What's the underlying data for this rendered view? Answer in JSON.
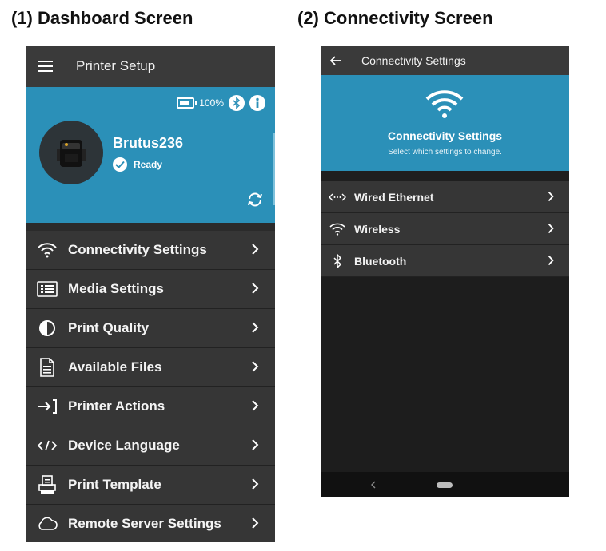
{
  "captions": {
    "left": "(1) Dashboard Screen",
    "right": "(2) Connectivity Screen"
  },
  "dashboard": {
    "title": "Printer Setup",
    "battery_text": "100%",
    "printer_name": "Brutus236",
    "printer_status": "Ready",
    "hero_color": "#2b90b8",
    "menu": [
      {
        "label": "Connectivity Settings",
        "icon": "wifi-icon"
      },
      {
        "label": "Media Settings",
        "icon": "list-icon"
      },
      {
        "label": "Print Quality",
        "icon": "contrast-icon"
      },
      {
        "label": "Available Files",
        "icon": "file-icon"
      },
      {
        "label": "Printer Actions",
        "icon": "enter-icon"
      },
      {
        "label": "Device Language",
        "icon": "code-icon"
      },
      {
        "label": "Print Template",
        "icon": "template-printer-icon"
      },
      {
        "label": "Remote Server Settings",
        "icon": "cloud-icon"
      }
    ]
  },
  "connectivity": {
    "title": "Connectivity Settings",
    "hero_title": "Connectivity Settings",
    "hero_subtitle": "Select which settings to change.",
    "items": [
      {
        "label": "Wired Ethernet",
        "icon": "ethernet-icon"
      },
      {
        "label": "Wireless",
        "icon": "wifi-icon"
      },
      {
        "label": "Bluetooth",
        "icon": "bluetooth-icon"
      }
    ]
  }
}
